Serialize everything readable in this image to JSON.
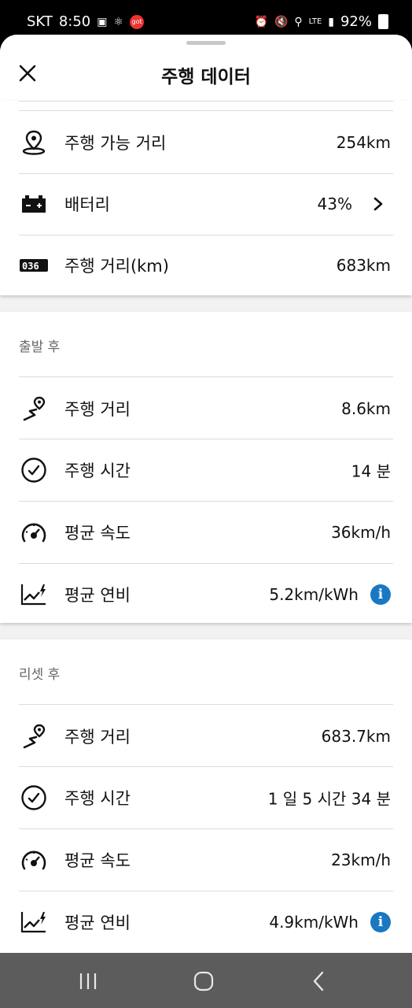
{
  "status_bar": {
    "carrier": "SKT",
    "time": "8:50",
    "got_badge": "got",
    "network": "LTE",
    "battery": "92%"
  },
  "header": {
    "title": "주행 데이터"
  },
  "vehicle": {
    "range": {
      "label": "주행 가능 거리",
      "value": "254km",
      "icon": "location-pin-icon"
    },
    "battery": {
      "label": "배터리",
      "value": "43%",
      "icon": "battery-icon"
    },
    "odometer": {
      "label": "주행 거리(km)",
      "value": "683km",
      "icon": "odometer-icon"
    }
  },
  "since_start": {
    "title": "출발 후",
    "distance": {
      "label": "주행 거리",
      "value": "8.6km"
    },
    "time": {
      "label": "주행 시간",
      "value": "14 분"
    },
    "speed": {
      "label": "평균 속도",
      "value": "36km/h"
    },
    "efficiency": {
      "label": "평균 연비",
      "value": "5.2km/kWh",
      "info": "i"
    }
  },
  "since_reset": {
    "title": "리셋 후",
    "distance": {
      "label": "주행 거리",
      "value": "683.7km"
    },
    "time": {
      "label": "주행 시간",
      "value": "1 일 5 시간 34 분"
    },
    "speed": {
      "label": "평균 속도",
      "value": "23km/h"
    },
    "efficiency": {
      "label": "평균 연비",
      "value": "4.9km/kWh",
      "info": "i"
    }
  },
  "colors": {
    "accent": "#1a78c2",
    "nav_bar": "#5c5c5c",
    "background": "#f2f2f2"
  }
}
